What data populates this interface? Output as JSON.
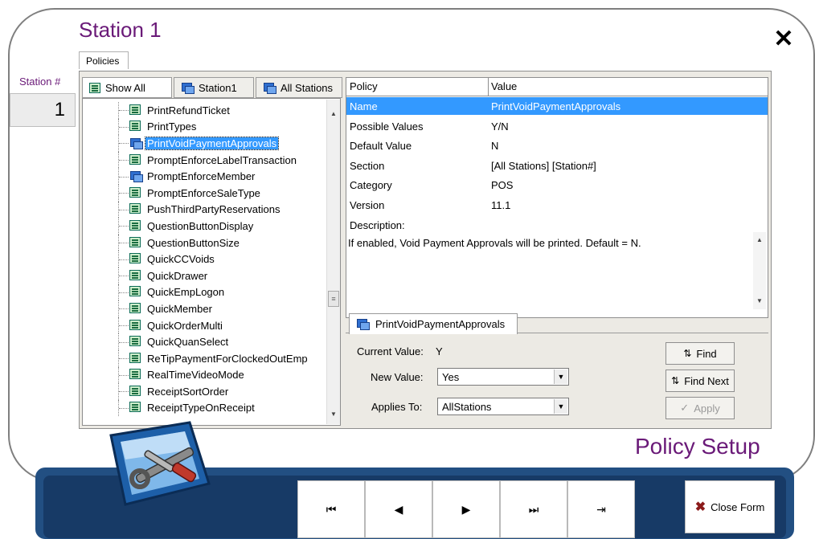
{
  "header": {
    "title": "Station 1",
    "close_icon": "close-icon",
    "close_glyph": "✕"
  },
  "tabs": {
    "policies": "Policies"
  },
  "station": {
    "label": "Station #",
    "number": "1"
  },
  "tree_tabs": {
    "show_all": "Show All",
    "station1": "Station1",
    "all_stations": "All Stations"
  },
  "tree": {
    "items": [
      {
        "label": "PrintRefundTicket",
        "icon": "policy-icon"
      },
      {
        "label": "PrintTypes",
        "icon": "policy-icon"
      },
      {
        "label": "PrintVoidPaymentApprovals",
        "icon": "stations-icon",
        "selected": true
      },
      {
        "label": "PromptEnforceLabelTransaction",
        "icon": "policy-icon"
      },
      {
        "label": "PromptEnforceMember",
        "icon": "stations-icon"
      },
      {
        "label": "PromptEnforceSaleType",
        "icon": "policy-icon"
      },
      {
        "label": "PushThirdPartyReservations",
        "icon": "policy-icon"
      },
      {
        "label": "QuestionButtonDisplay",
        "icon": "policy-icon"
      },
      {
        "label": "QuestionButtonSize",
        "icon": "policy-icon"
      },
      {
        "label": "QuickCCVoids",
        "icon": "policy-icon"
      },
      {
        "label": "QuickDrawer",
        "icon": "policy-icon"
      },
      {
        "label": "QuickEmpLogon",
        "icon": "policy-icon"
      },
      {
        "label": "QuickMember",
        "icon": "policy-icon"
      },
      {
        "label": "QuickOrderMulti",
        "icon": "policy-icon"
      },
      {
        "label": "QuickQuanSelect",
        "icon": "policy-icon"
      },
      {
        "label": "ReTipPaymentForClockedOutEmp",
        "icon": "policy-icon"
      },
      {
        "label": "RealTimeVideoMode",
        "icon": "policy-icon"
      },
      {
        "label": "ReceiptSortOrder",
        "icon": "policy-icon"
      },
      {
        "label": "ReceiptTypeOnReceipt",
        "icon": "policy-icon"
      }
    ]
  },
  "policy_table": {
    "headers": {
      "policy": "Policy",
      "value": "Value"
    },
    "rows": [
      {
        "key": "Name",
        "value": "PrintVoidPaymentApprovals",
        "selected": true
      },
      {
        "key": "Possible Values",
        "value": "Y/N"
      },
      {
        "key": "Default Value",
        "value": "N"
      },
      {
        "key": "Section",
        "value": "[All Stations] [Station#]"
      },
      {
        "key": "Category",
        "value": "POS"
      },
      {
        "key": "Version",
        "value": "11.1"
      }
    ],
    "description_label": "Description:",
    "description": "If enabled, Void Payment Approvals will be printed. Default = N."
  },
  "editor": {
    "tab_label": "PrintVoidPaymentApprovals",
    "current_label": "Current Value:",
    "current_value": "Y",
    "new_label": "New Value:",
    "new_value": "Yes",
    "applies_label": "Applies To:",
    "applies_value": "AllStations",
    "find": "Find",
    "find_next": "Find Next",
    "apply": "Apply"
  },
  "footer": {
    "policy_setup": "Policy Setup",
    "nav": {
      "first": "⏮",
      "prev": "◀",
      "next": "▶",
      "last": "⏭",
      "end": "⇥"
    },
    "close_form": "Close Form"
  }
}
